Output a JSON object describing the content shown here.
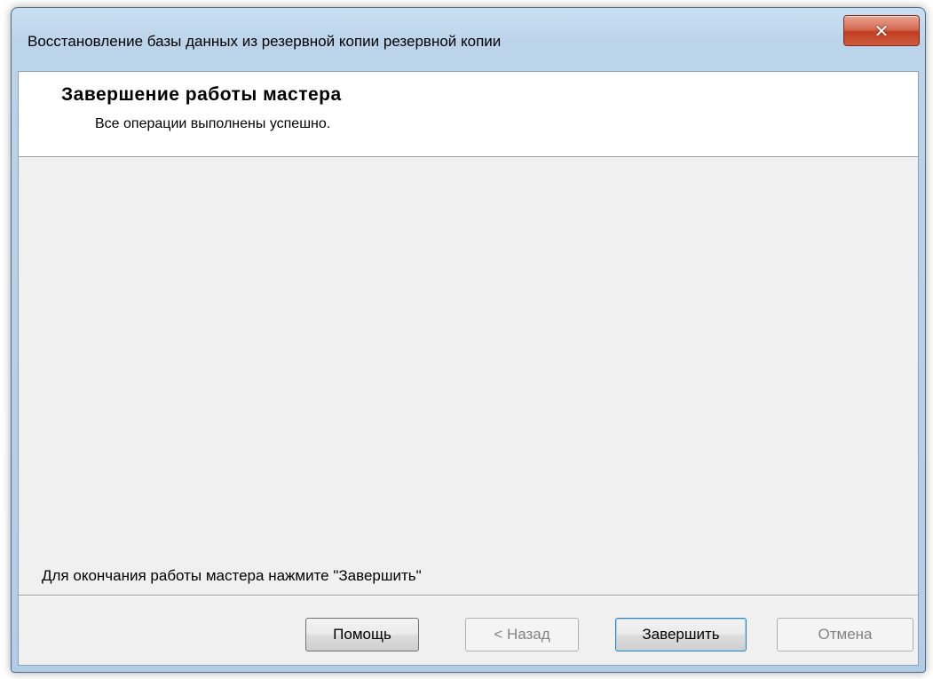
{
  "window": {
    "title": "Восстановление базы данных из резервной копии резервной копии",
    "close_icon": "close-icon"
  },
  "header": {
    "title": "Завершение работы мастера",
    "subtitle": "Все операции выполнены успешно."
  },
  "body": {
    "footer_hint": "Для окончания работы мастера нажмите \"Завершить\""
  },
  "buttons": {
    "help": "Помощь",
    "back": "< Назад",
    "finish": "Завершить",
    "cancel": "Отмена"
  }
}
